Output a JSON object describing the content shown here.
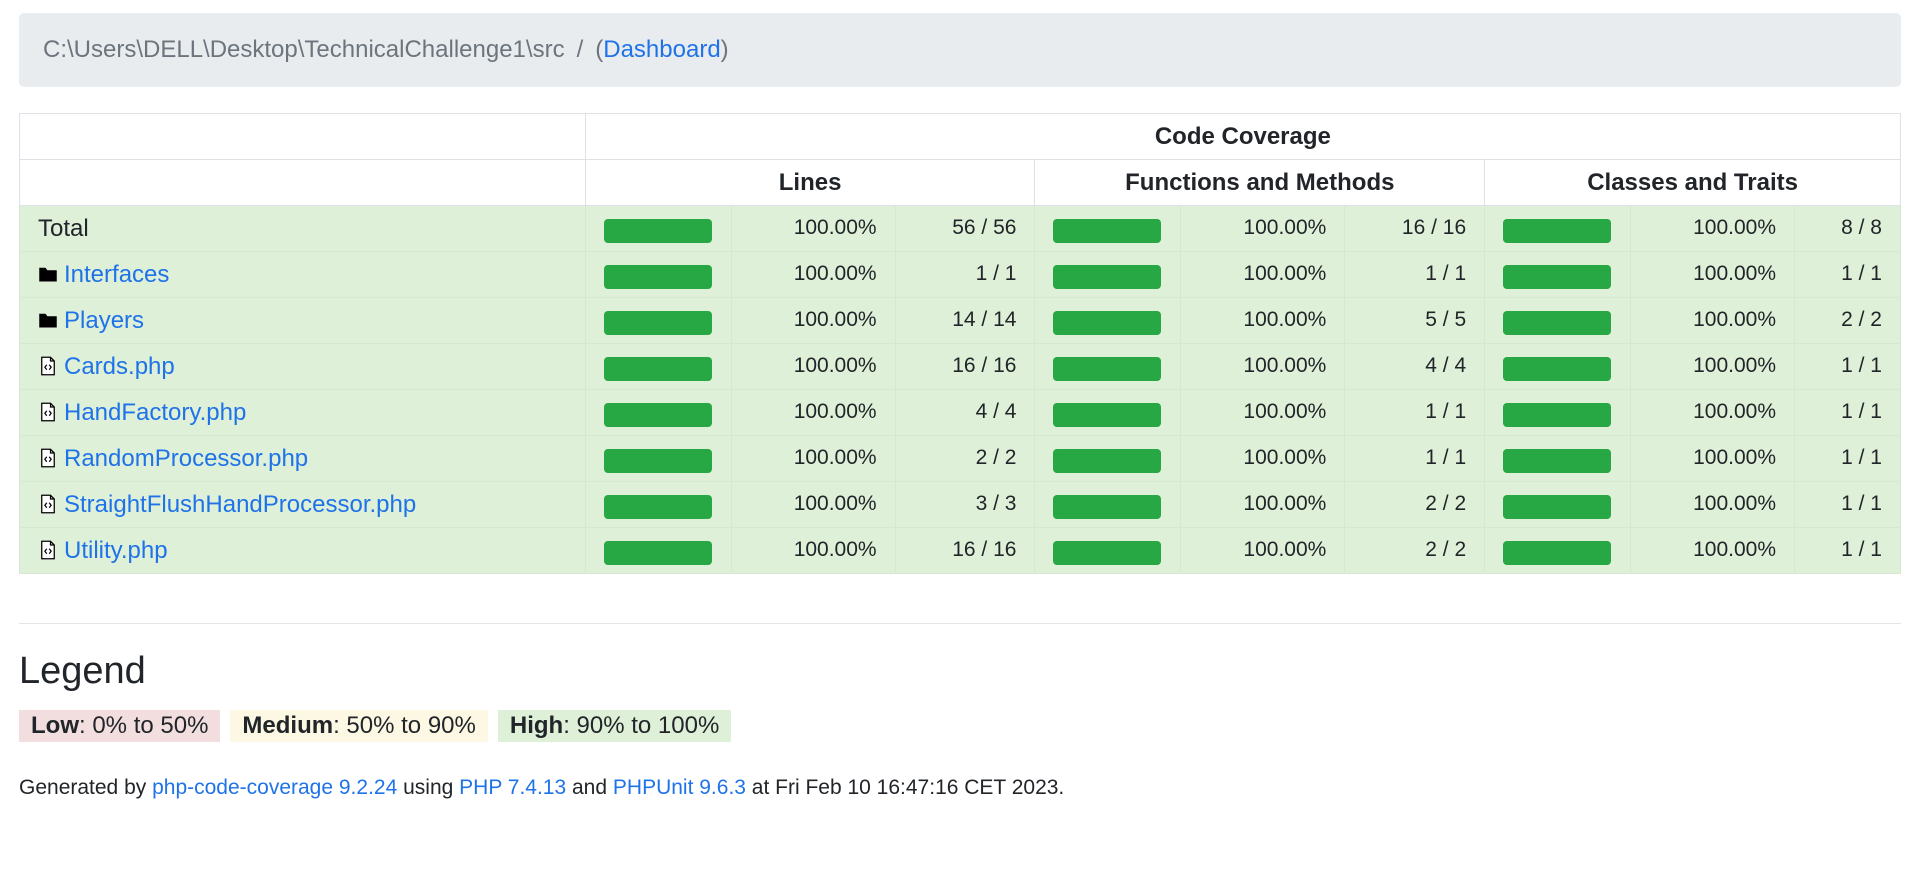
{
  "breadcrumb": {
    "path": "C:\\Users\\DELL\\Desktop\\TechnicalChallenge1\\src",
    "separator": "/",
    "open_paren": "(",
    "dashboard_link": "Dashboard",
    "close_paren": ")"
  },
  "table": {
    "header_main": "Code Coverage",
    "header_lines": "Lines",
    "header_functions": "Functions and Methods",
    "header_classes": "Classes and Traits",
    "rows": [
      {
        "name": "Total",
        "type": "total",
        "lines_pct": "100.00%",
        "lines_ratio": "56 / 56",
        "func_pct": "100.00%",
        "func_ratio": "16 / 16",
        "class_pct": "100.00%",
        "class_ratio": "8 / 8"
      },
      {
        "name": "Interfaces",
        "type": "folder",
        "lines_pct": "100.00%",
        "lines_ratio": "1 / 1",
        "func_pct": "100.00%",
        "func_ratio": "1 / 1",
        "class_pct": "100.00%",
        "class_ratio": "1 / 1"
      },
      {
        "name": "Players",
        "type": "folder",
        "lines_pct": "100.00%",
        "lines_ratio": "14 / 14",
        "func_pct": "100.00%",
        "func_ratio": "5 / 5",
        "class_pct": "100.00%",
        "class_ratio": "2 / 2"
      },
      {
        "name": "Cards.php",
        "type": "file",
        "lines_pct": "100.00%",
        "lines_ratio": "16 / 16",
        "func_pct": "100.00%",
        "func_ratio": "4 / 4",
        "class_pct": "100.00%",
        "class_ratio": "1 / 1"
      },
      {
        "name": "HandFactory.php",
        "type": "file",
        "lines_pct": "100.00%",
        "lines_ratio": "4 / 4",
        "func_pct": "100.00%",
        "func_ratio": "1 / 1",
        "class_pct": "100.00%",
        "class_ratio": "1 / 1"
      },
      {
        "name": "RandomProcessor.php",
        "type": "file",
        "lines_pct": "100.00%",
        "lines_ratio": "2 / 2",
        "func_pct": "100.00%",
        "func_ratio": "1 / 1",
        "class_pct": "100.00%",
        "class_ratio": "1 / 1"
      },
      {
        "name": "StraightFlushHandProcessor.php",
        "type": "file",
        "lines_pct": "100.00%",
        "lines_ratio": "3 / 3",
        "func_pct": "100.00%",
        "func_ratio": "2 / 2",
        "class_pct": "100.00%",
        "class_ratio": "1 / 1"
      },
      {
        "name": "Utility.php",
        "type": "file",
        "lines_pct": "100.00%",
        "lines_ratio": "16 / 16",
        "func_pct": "100.00%",
        "func_ratio": "2 / 2",
        "class_pct": "100.00%",
        "class_ratio": "1 / 1"
      }
    ]
  },
  "legend": {
    "title": "Legend",
    "low_label": "Low",
    "low_range": ": 0% to 50%",
    "medium_label": "Medium",
    "medium_range": ": 50% to 90%",
    "high_label": "High",
    "high_range": ": 90% to 100%"
  },
  "footer": {
    "generated_by": "Generated by ",
    "tool_link": "php-code-coverage 9.2.24",
    "using": " using ",
    "php_link": "PHP 7.4.13",
    "and": " and ",
    "phpunit_link": "PHPUnit 9.6.3",
    "at": " at Fri Feb 10 16:47:16 CET 2023."
  },
  "colors": {
    "bar_fill": "#28a745",
    "row_high": "#dff0d8",
    "link": "#1f73e8"
  }
}
